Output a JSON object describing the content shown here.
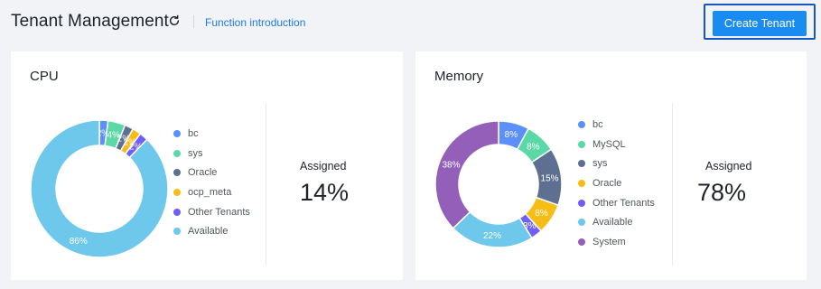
{
  "header": {
    "title": "Tenant Management",
    "function_link": "Function introduction",
    "create_button": "Create Tenant",
    "refresh_icon": "refresh-icon"
  },
  "colors": {
    "accent": "#1a8bf0",
    "link": "#1f7ae0"
  },
  "cpu": {
    "title": "CPU",
    "assigned_label": "Assigned",
    "assigned_value": "14%",
    "legend": [
      {
        "label": "bc",
        "color": "#5b8ff9"
      },
      {
        "label": "sys",
        "color": "#5ad8a6"
      },
      {
        "label": "Oracle",
        "color": "#5d7092"
      },
      {
        "label": "ocp_meta",
        "color": "#f6bd16"
      },
      {
        "label": "Other Tenants",
        "color": "#6f5ef9"
      },
      {
        "label": "Available",
        "color": "#6dc8ec"
      }
    ],
    "slices": [
      {
        "name": "bc",
        "value": 2,
        "label": "2%",
        "color": "#5b8ff9"
      },
      {
        "name": "sys",
        "value": 4,
        "label": "4%",
        "color": "#5ad8a6"
      },
      {
        "name": "Oracle",
        "value": 2,
        "label": "2%",
        "color": "#5d7092"
      },
      {
        "name": "ocp_meta",
        "value": 2,
        "label": "2%",
        "color": "#f6bd16"
      },
      {
        "name": "Other Tenants",
        "value": 2,
        "label": "2%",
        "color": "#6f5ef9"
      },
      {
        "name": "Available",
        "value": 86,
        "label": "86%",
        "color": "#6dc8ec"
      }
    ]
  },
  "memory": {
    "title": "Memory",
    "assigned_label": "Assigned",
    "assigned_value": "78%",
    "legend": [
      {
        "label": "bc",
        "color": "#5b8ff9"
      },
      {
        "label": "MySQL",
        "color": "#5ad8a6"
      },
      {
        "label": "sys",
        "color": "#5d7092"
      },
      {
        "label": "Oracle",
        "color": "#f6bd16"
      },
      {
        "label": "Other Tenants",
        "color": "#6f5ef9"
      },
      {
        "label": "Available",
        "color": "#6dc8ec"
      },
      {
        "label": "System",
        "color": "#945fb9"
      }
    ],
    "slices": [
      {
        "name": "bc",
        "value": 8,
        "label": "8%",
        "color": "#5b8ff9"
      },
      {
        "name": "MySQL",
        "value": 8,
        "label": "8%",
        "color": "#5ad8a6"
      },
      {
        "name": "sys",
        "value": 15,
        "label": "15%",
        "color": "#5d7092"
      },
      {
        "name": "Oracle",
        "value": 8,
        "label": "8%",
        "color": "#f6bd16"
      },
      {
        "name": "Other Tenants",
        "value": 3,
        "label": "3%",
        "color": "#6f5ef9"
      },
      {
        "name": "Available",
        "value": 22,
        "label": "22%",
        "color": "#6dc8ec"
      },
      {
        "name": "System",
        "value": 38,
        "label": "38%",
        "color": "#945fb9"
      }
    ]
  },
  "chart_data": [
    {
      "type": "pie",
      "title": "CPU",
      "categories": [
        "bc",
        "sys",
        "Oracle",
        "ocp_meta",
        "Other Tenants",
        "Available"
      ],
      "values": [
        2,
        4,
        2,
        2,
        2,
        86
      ]
    },
    {
      "type": "pie",
      "title": "Memory",
      "categories": [
        "bc",
        "MySQL",
        "sys",
        "Oracle",
        "Other Tenants",
        "Available",
        "System"
      ],
      "values": [
        8,
        8,
        15,
        8,
        3,
        22,
        38
      ]
    }
  ]
}
